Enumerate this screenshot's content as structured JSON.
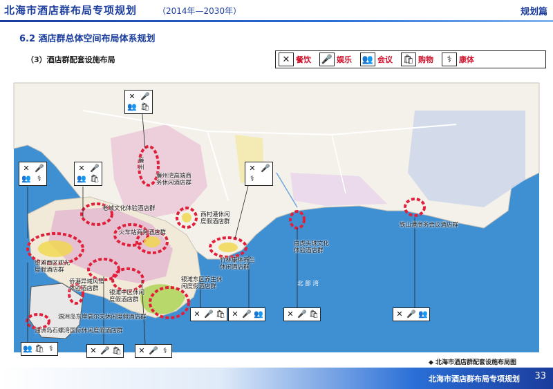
{
  "header": {
    "title": "北海市酒店群布局专项规划",
    "years": "（2014年—2030年）",
    "tag": "规划篇"
  },
  "section_title": "6.2 酒店群总体空间布局体系规划",
  "sub_title": "（3）酒店群配套设施布局",
  "legend": [
    {
      "icon": "utensils-icon",
      "glyph": "✕",
      "label": "餐饮"
    },
    {
      "icon": "microphone-icon",
      "glyph": "🎤",
      "label": "娱乐"
    },
    {
      "icon": "meeting-icon",
      "glyph": "👥",
      "label": "会议"
    },
    {
      "icon": "shopping-icon",
      "glyph": "🛍",
      "label": "购物"
    },
    {
      "icon": "fitness-icon",
      "glyph": "⚕",
      "label": "康体"
    }
  ],
  "map": {
    "labels": {
      "laocheng": "老城文化体验酒店群",
      "lianzhou": "廉州湾高端商\n务休闲酒店群",
      "huochezhan": "火车站商务酒店群",
      "xicun": "西村港休闲\n度假酒店群",
      "zhuwei": "竹林康体养生\n休闲酒店群",
      "yintan_west": "银滩西区观光\n度假酒店群",
      "qiaogang": "侨港异域风情\n体验酒店群",
      "yintan_mid": "银滩中区休闲\n度假酒店群",
      "yintan_east": "银滩东区养生休\n闲度假酒店群",
      "weizhou_east": "涠洲岛东岸高尔夫休闲度假酒店群",
      "weizhou_shi": "涠洲岛石螺湾国际休闲度假酒店群",
      "baihu": "白虎头珠文化\n体验酒店群",
      "tieshan": "铁山港商务会议酒店群",
      "beibu": "北 部 湾",
      "lianzhou_river": "廉\n州"
    },
    "caption": "◆ 北海市酒店群配套设施布局图"
  },
  "footer": {
    "text": "北海市酒店群布局专项规划",
    "page": "33"
  },
  "colors": {
    "brand": "#1a3c9c",
    "accent": "#d0112b",
    "sea": "#3f8fd3",
    "land": "#f4f1ea",
    "ring": "#e0203a"
  }
}
